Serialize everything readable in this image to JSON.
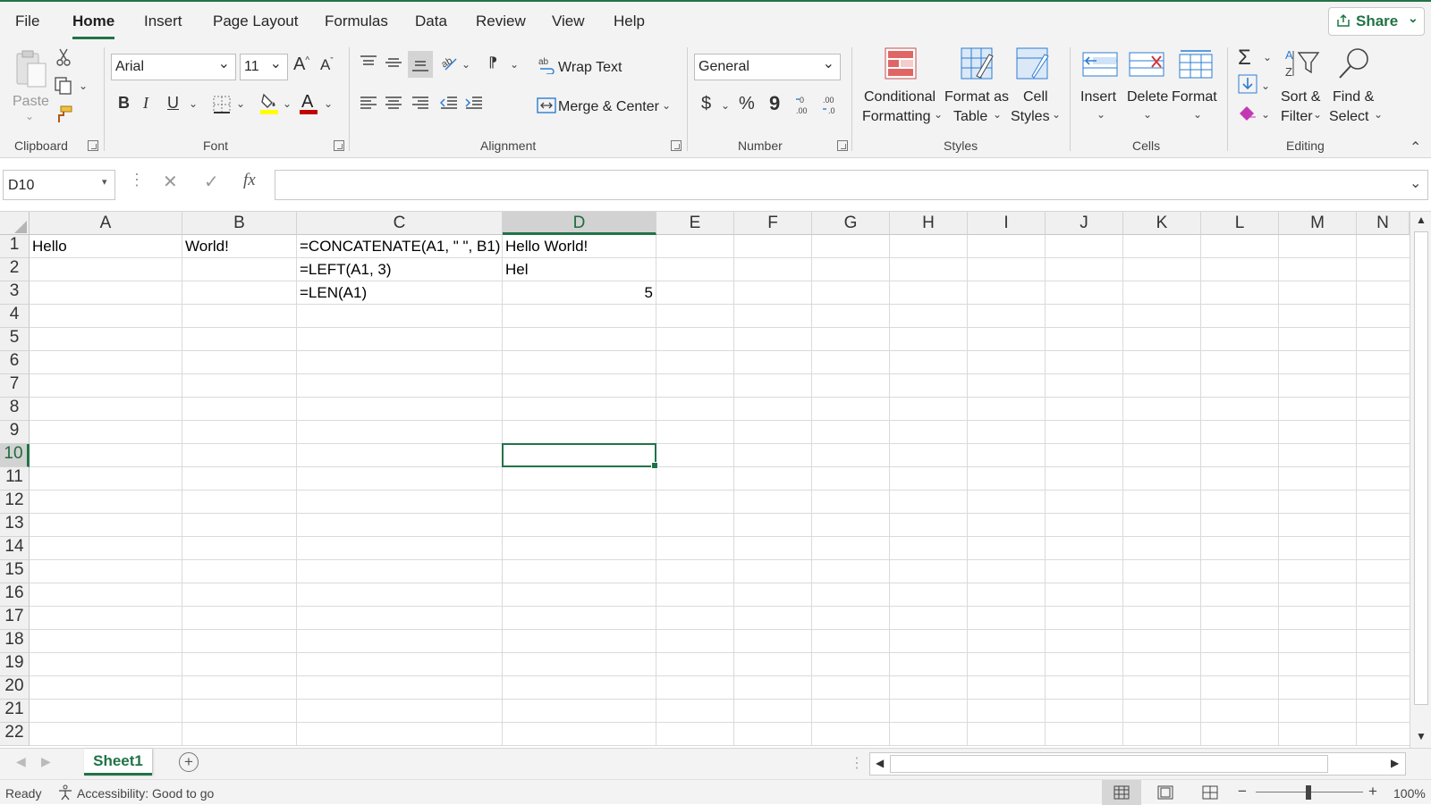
{
  "tabs": [
    "File",
    "Home",
    "Insert",
    "Page Layout",
    "Formulas",
    "Data",
    "Review",
    "View",
    "Help"
  ],
  "active_tab": "Home",
  "share_label": "Share",
  "ribbon": {
    "clipboard": {
      "paste": "Paste",
      "label": "Clipboard"
    },
    "font": {
      "name": "Arial",
      "size": "11",
      "label": "Font",
      "bold": "B",
      "italic": "I",
      "underline": "U",
      "grow": "A",
      "shrink": "A"
    },
    "alignment": {
      "wrap": "Wrap Text",
      "merge": "Merge & Center",
      "label": "Alignment"
    },
    "number": {
      "format": "General",
      "label": "Number",
      "currency": "$",
      "percent": "%",
      "comma": "9"
    },
    "styles": {
      "conditional": [
        "Conditional",
        "Formatting"
      ],
      "format_table": [
        "Format as",
        "Table"
      ],
      "cell_styles": [
        "Cell",
        "Styles"
      ],
      "label": "Styles"
    },
    "cells": {
      "insert": "Insert",
      "delete": "Delete",
      "format": "Format",
      "label": "Cells"
    },
    "editing": {
      "sort": [
        "Sort &",
        "Filter"
      ],
      "find": [
        "Find &",
        "Select"
      ],
      "label": "Editing"
    },
    "colors": {
      "fill": "#ffff00",
      "font": "#c00000",
      "accent": "#217346"
    }
  },
  "namebox": "D10",
  "formula_value": "",
  "columns": [
    "A",
    "B",
    "C",
    "D",
    "E",
    "F",
    "G",
    "H",
    "I",
    "J",
    "K",
    "L",
    "M",
    "N"
  ],
  "rows": [
    "1",
    "2",
    "3",
    "4",
    "5",
    "6",
    "7",
    "8",
    "9",
    "10",
    "11",
    "12",
    "13",
    "14",
    "15",
    "16",
    "17",
    "18",
    "19",
    "20",
    "21",
    "22"
  ],
  "selected": {
    "col": "D",
    "row": "10"
  },
  "cells": {
    "A1": "Hello",
    "B1": "World!",
    "C1": "=CONCATENATE(A1, \" \", B1)",
    "D1": "Hello World!",
    "C2": "=LEFT(A1, 3)",
    "D2": "Hel",
    "C3": "=LEN(A1)",
    "D3": "5"
  },
  "sheet_tab": "Sheet1",
  "status": {
    "ready": "Ready",
    "accessibility": "Accessibility: Good to go",
    "zoom": "100%"
  }
}
